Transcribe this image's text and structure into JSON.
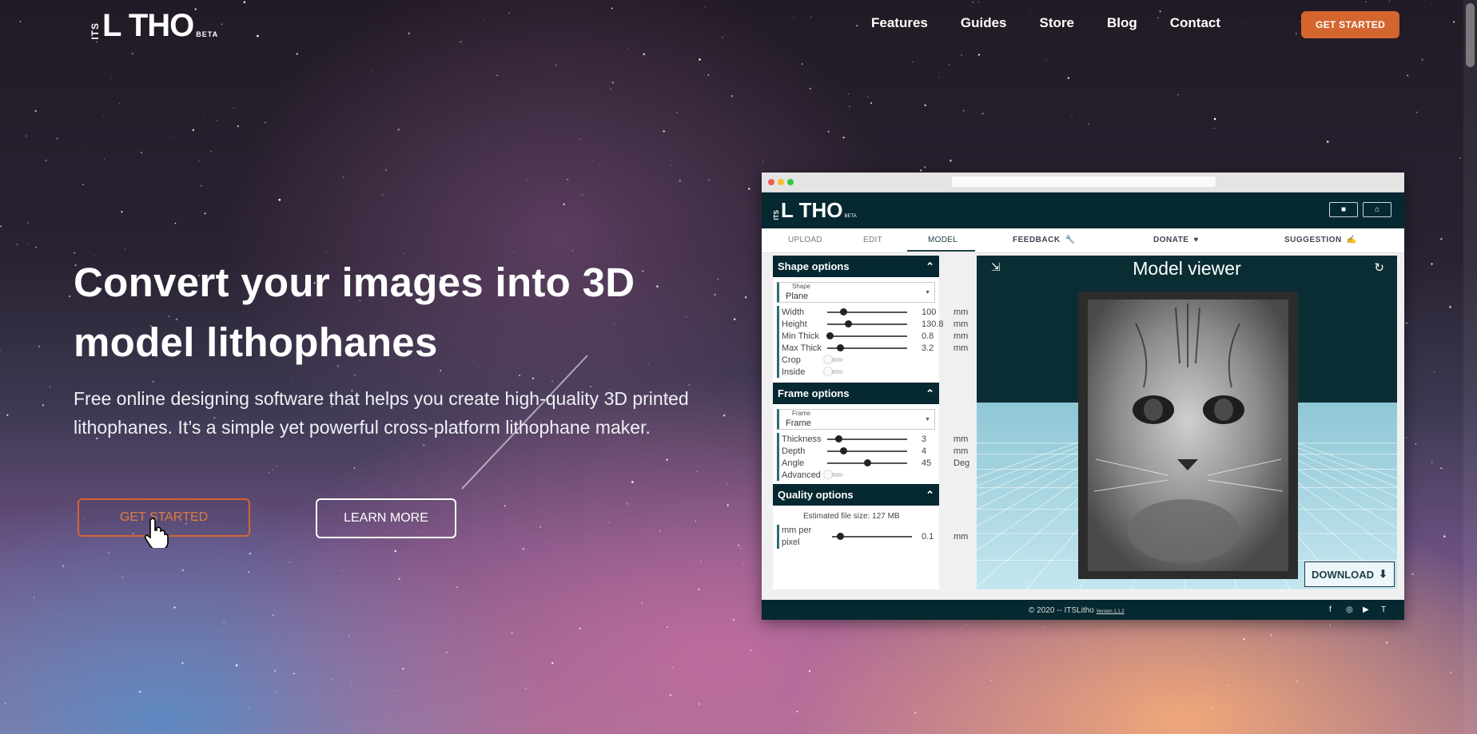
{
  "colors": {
    "accent": "#d4652f",
    "app_dark": "#062830"
  },
  "header": {
    "logo": {
      "its": "ITS",
      "main": "L THO",
      "beta": "BETA"
    },
    "nav": [
      "Features",
      "Guides",
      "Store",
      "Blog",
      "Contact"
    ],
    "cta": "GET STARTED"
  },
  "hero": {
    "title": "Convert your images into 3D model lithophanes",
    "subtitle": "Free online designing software that helps you create high-quality 3D printed lithophanes. It’s a simple yet powerful cross-platform lithophane maker.",
    "get_started": "GET STARTED",
    "learn_more": "LEARN MORE"
  },
  "mock": {
    "logo": {
      "its": "ITS",
      "main": "L THO",
      "beta": "BETA"
    },
    "tabs": [
      "UPLOAD",
      "EDIT",
      "MODEL"
    ],
    "right_tabs": [
      "FEEDBACK",
      "DONATE",
      "SUGGESTION"
    ],
    "shape": {
      "title": "Shape options",
      "select_label": "Shape",
      "select_value": "Plane",
      "rows": [
        {
          "name": "Width",
          "value": "100",
          "unit": "mm",
          "pos": 0.2
        },
        {
          "name": "Height",
          "value": "130.8",
          "unit": "mm",
          "pos": 0.26
        },
        {
          "name": "Min Thick",
          "value": "0.8",
          "unit": "mm",
          "pos": 0.03
        },
        {
          "name": "Max Thick",
          "value": "3.2",
          "unit": "mm",
          "pos": 0.16
        }
      ],
      "toggles": [
        "Crop",
        "Inside"
      ]
    },
    "frame": {
      "title": "Frame options",
      "select_label": "Frame",
      "select_value": "Frame",
      "rows": [
        {
          "name": "Thickness",
          "value": "3",
          "unit": "mm",
          "pos": 0.14
        },
        {
          "name": "Depth",
          "value": "4",
          "unit": "mm",
          "pos": 0.2
        },
        {
          "name": "Angle",
          "value": "45",
          "unit": "Deg",
          "pos": 0.5
        }
      ],
      "toggle": "Advanced"
    },
    "quality": {
      "title": "Quality options",
      "estimate": "Estimated file size: 127 MB",
      "row": {
        "name1": "mm per",
        "name2": "pixel",
        "value": "0.1",
        "unit": "mm",
        "pos": 0.1
      }
    },
    "viewer_title": "Model viewer",
    "download": "DOWNLOAD",
    "footer": {
      "copyright": "© 2020 -- ITSLitho",
      "version": "Version 1.1.2"
    }
  }
}
